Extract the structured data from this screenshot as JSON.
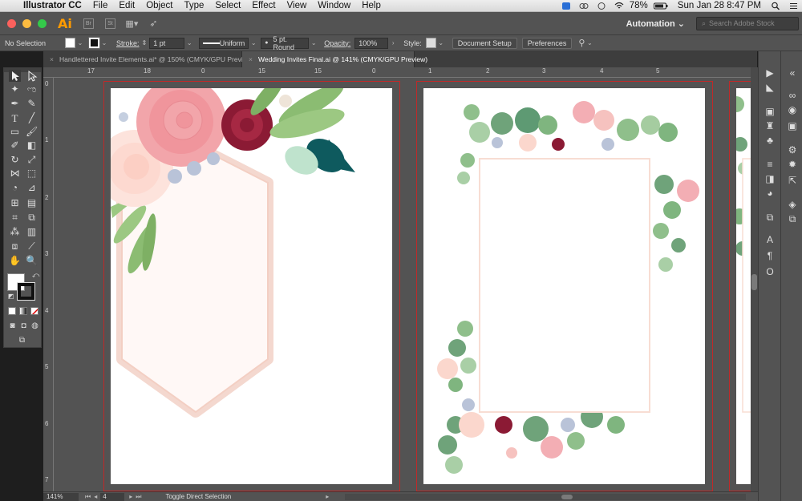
{
  "menubar": {
    "apple": "",
    "app_name": "Illustrator CC",
    "items": [
      "File",
      "Edit",
      "Object",
      "Type",
      "Select",
      "Effect",
      "View",
      "Window",
      "Help"
    ],
    "battery": "78%",
    "clock": "Sun Jan 28  8:47 PM"
  },
  "appbar": {
    "logo": "Ai",
    "bridge_label": "Br",
    "stock_label": "St",
    "workspace": "Automation",
    "stock_search_placeholder": "Search Adobe Stock"
  },
  "control": {
    "selection": "No Selection",
    "stroke_label": "Stroke:",
    "stroke_weight": "1 pt",
    "profile": "Uniform",
    "brush": "5 pt. Round",
    "opacity_label": "Opacity:",
    "opacity": "100%",
    "style_label": "Style:",
    "document_setup": "Document Setup",
    "preferences": "Preferences"
  },
  "tabs": [
    {
      "label": "Handlettered Invite Elements.ai* @ 150% (CMYK/GPU Preview)",
      "close": "×"
    },
    {
      "label": "Wedding Invites Final.ai @ 141% (CMYK/GPU Preview)",
      "close": "×"
    }
  ],
  "rulers": {
    "h_ticks": [
      "17",
      "18",
      "0",
      "15",
      "15",
      "0",
      "1",
      "2",
      "3",
      "4",
      "5"
    ],
    "v_ticks": [
      "0",
      "1",
      "2",
      "3",
      "4",
      "5",
      "6",
      "7"
    ]
  },
  "status": {
    "zoom": "141%",
    "artboard": "4",
    "message": "Toggle Direct Selection"
  },
  "colors": {
    "accent_pink": "#f0949f",
    "burgundy": "#8b1a34",
    "sage": "#7fb57f",
    "teal_leaf": "#0e5a5e",
    "bleed_red": "#c02929"
  }
}
